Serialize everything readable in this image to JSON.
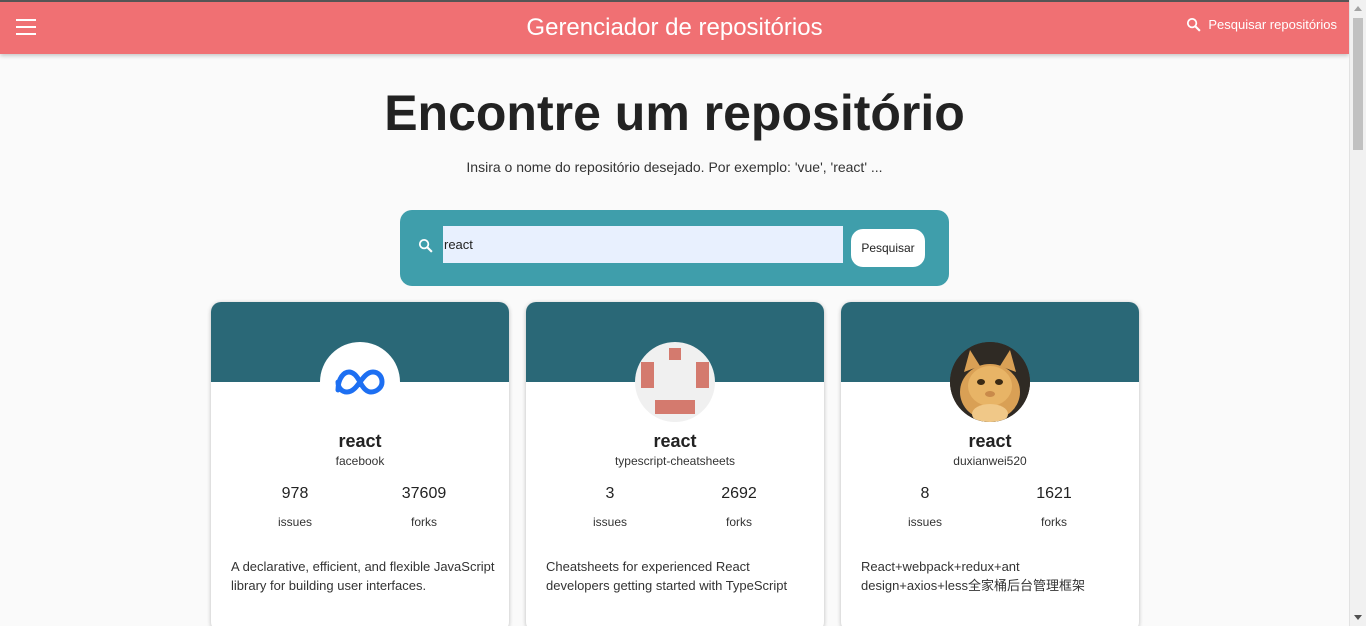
{
  "header": {
    "title": "Gerenciador de repositórios",
    "search_link": "Pesquisar repositórios"
  },
  "hero": {
    "title": "Encontre um repositório",
    "subtitle": "Insira o nome do repositório desejado. Por exemplo: 'vue', 'react' ..."
  },
  "search": {
    "value": "react",
    "button_label": "Pesquisar"
  },
  "cards": [
    {
      "name": "react",
      "owner": "facebook",
      "issues": "978",
      "forks": "37609",
      "issues_label": "issues",
      "forks_label": "forks",
      "description": "A declarative, efficient, and flexible JavaScript library for building user interfaces."
    },
    {
      "name": "react",
      "owner": "typescript-cheatsheets",
      "issues": "3",
      "forks": "2692",
      "issues_label": "issues",
      "forks_label": "forks",
      "description": "Cheatsheets for experienced React developers getting started with TypeScript"
    },
    {
      "name": "react",
      "owner": "duxianwei520",
      "issues": "8",
      "forks": "1621",
      "issues_label": "issues",
      "forks_label": "forks",
      "description": "React+webpack+redux+ant design+axios+less全家桶后台管理框架"
    }
  ],
  "icons": {
    "menu": "menu-icon",
    "search": "search-icon"
  },
  "colors": {
    "topbar": "#f07073",
    "search_box": "#3f9eab",
    "card_header": "#2a6877"
  }
}
